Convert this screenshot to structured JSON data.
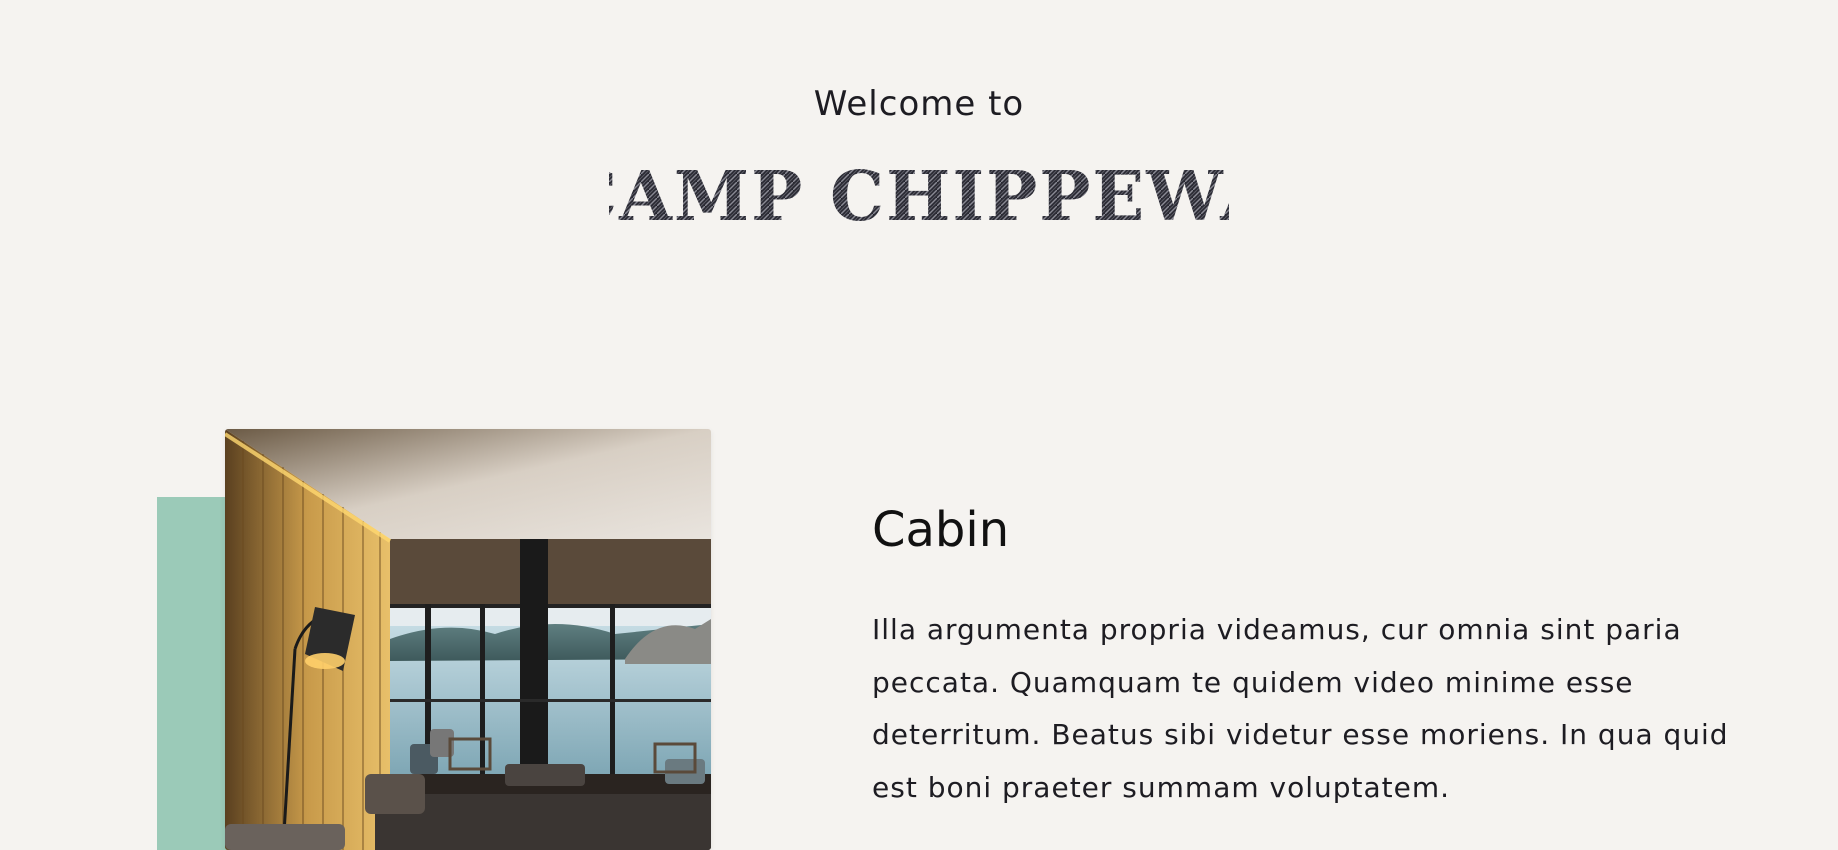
{
  "header": {
    "welcome": "Welcome to",
    "brand": "CAMP CHIPPEWA"
  },
  "feature": {
    "title": "Cabin",
    "body": "Illa argumenta propria videamus, cur omnia sint paria peccata. Quamquam te quidem video minime esse deterritum. Beatus sibi videtur esse moriens. In qua quid est boni praeter summam voluptatem.",
    "accent_color": "#9bcab8"
  },
  "colors": {
    "background": "#f5f3f0",
    "text": "#1d1c22"
  }
}
